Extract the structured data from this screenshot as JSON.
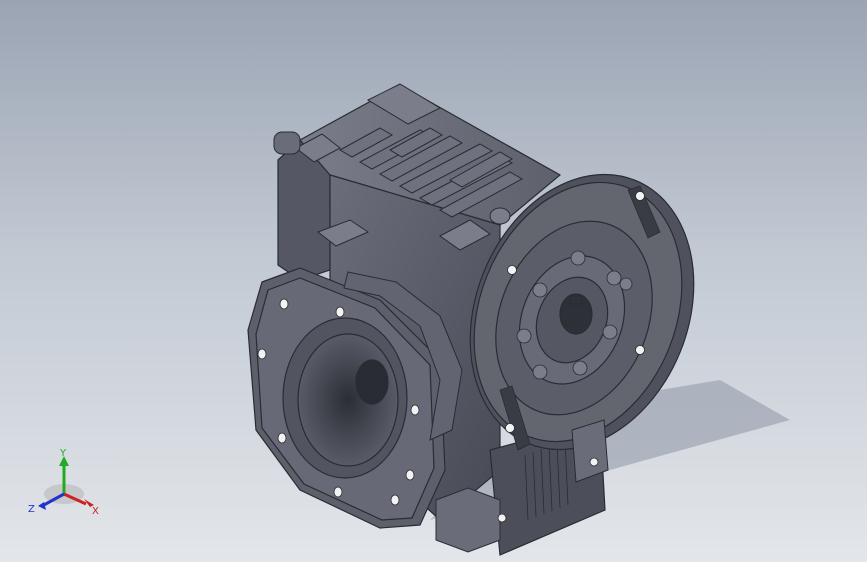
{
  "viewport": {
    "background_top": "#9aa4b3",
    "background_bottom": "#e3e6ea",
    "model": {
      "name": "worm-gear-reducer",
      "body_color": "#5a5d69",
      "shadow_color": "#3f424c"
    }
  },
  "triad": {
    "x_label": "X",
    "y_label": "Y",
    "z_label": "Z",
    "x_color": "#cc2222",
    "y_color": "#22aa22",
    "z_color": "#2233cc"
  }
}
